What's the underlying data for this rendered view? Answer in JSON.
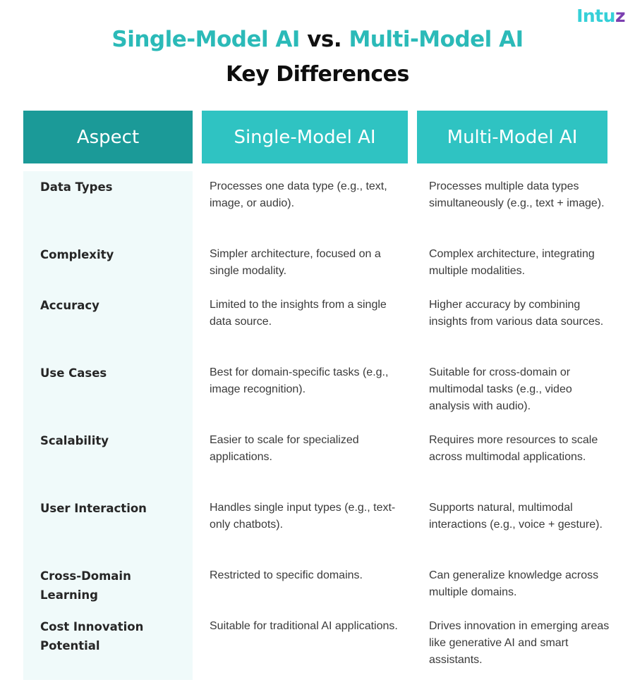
{
  "brand": {
    "logo_main": "Intu",
    "logo_end": "z",
    "accent_color": "#2bbab8",
    "header_dark": "#1b9a98",
    "header_light": "#2fc3c2",
    "aspect_bg": "#f0fafa"
  },
  "title": {
    "part1": "Single-Model AI",
    "vs": " vs. ",
    "part2": "Multi-Model AI"
  },
  "subtitle": "Key Differences",
  "table": {
    "headers": [
      "Aspect",
      "Single-Model AI",
      "Multi-Model AI"
    ],
    "rows": [
      {
        "aspect": "Data Types",
        "single": "Processes one data type (e.g., text, image, or audio).",
        "multi": "Processes multiple data types simultaneously (e.g., text + image)."
      },
      {
        "aspect": "Complexity",
        "single": "Simpler architecture, focused on a single modality.",
        "multi": "Complex architecture, integrating multiple modalities."
      },
      {
        "aspect": "Accuracy",
        "single": "Limited to the insights from a single data source.",
        "multi": "Higher accuracy by combining insights from various data sources."
      },
      {
        "aspect": "Use Cases",
        "single": "Best for domain-specific tasks (e.g., image recognition).",
        "multi": "Suitable for cross-domain or multimodal tasks (e.g., video analysis with audio)."
      },
      {
        "aspect": "Scalability",
        "single": "Easier to scale for specialized applications.",
        "multi": "Requires more resources to scale across multimodal applications."
      },
      {
        "aspect": "User Interaction",
        "single": "Handles single input types (e.g., text-only chatbots).",
        "multi": "Supports natural, multimodal interactions (e.g., voice + gesture)."
      },
      {
        "aspect": "Cross-Domain Learning",
        "single": "Restricted to specific domains.",
        "multi": "Can generalize knowledge across multiple domains."
      },
      {
        "aspect": "Cost Innovation Potential",
        "single": "Suitable for traditional AI applications.",
        "multi": "Drives innovation in emerging areas like generative AI and smart assistants."
      }
    ]
  }
}
